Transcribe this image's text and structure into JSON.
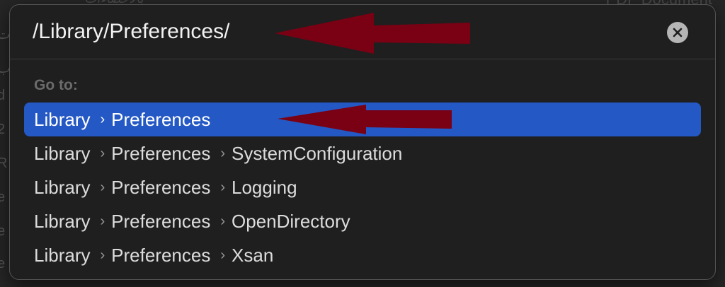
{
  "background": {
    "fragments": [
      "ت",
      "ب",
      "d",
      "2",
      "R",
      "e",
      "e",
      "e"
    ],
    "top_left": "بالاحصاءات",
    "top_right": "PDF Document"
  },
  "go_to_dialog": {
    "path_value": "/Library/Preferences/",
    "clear_icon": "clear-circle-x-icon",
    "section_label": "Go to:",
    "separator": "›",
    "results": [
      {
        "crumbs": [
          "Library",
          "Preferences"
        ],
        "selected": true
      },
      {
        "crumbs": [
          "Library",
          "Preferences",
          "SystemConfiguration"
        ],
        "selected": false
      },
      {
        "crumbs": [
          "Library",
          "Preferences",
          "Logging"
        ],
        "selected": false
      },
      {
        "crumbs": [
          "Library",
          "Preferences",
          "OpenDirectory"
        ],
        "selected": false
      },
      {
        "crumbs": [
          "Library",
          "Preferences",
          "Xsan"
        ],
        "selected": false
      }
    ]
  },
  "colors": {
    "selection": "#2458c4",
    "annotation_arrow": "#7a0014",
    "dialog_bg": "#1f1f1f"
  }
}
